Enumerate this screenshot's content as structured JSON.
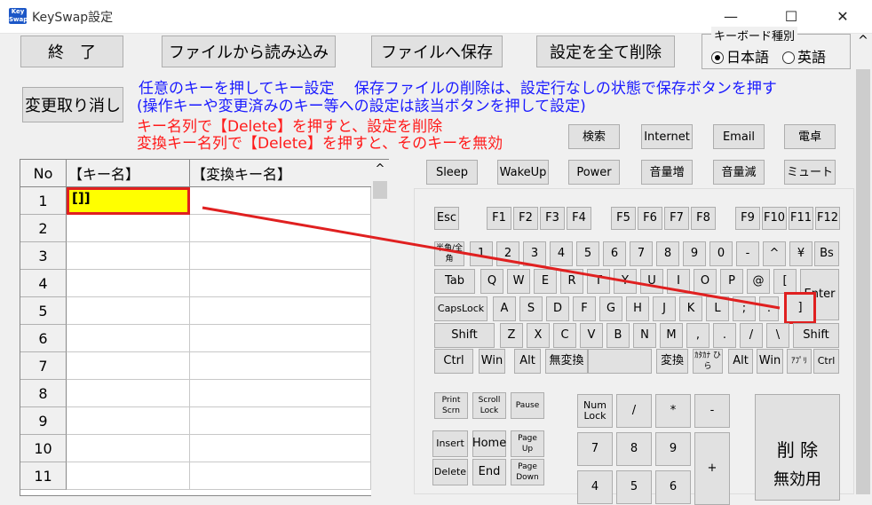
{
  "window": {
    "title": "KeySwap設定",
    "icon_text": "Key Swap",
    "minimize_glyph": "—",
    "maximize_glyph": "☐",
    "close_glyph": "✕"
  },
  "toolbar": {
    "exit_label": "終　了",
    "load_label": "ファイルから読み込み",
    "save_label": "ファイルへ保存",
    "delete_all_label": "設定を全て削除",
    "undo_label": "変更取り消し"
  },
  "keyboard_type": {
    "caption": "キーボード種別",
    "options": [
      {
        "label": "日本語",
        "selected": true
      },
      {
        "label": "英語",
        "selected": false
      }
    ]
  },
  "instructions": {
    "blue_line1": "任意のキーを押してキー設定　  保存ファイルの削除は、設定行なしの状態で保存ボタンを押す",
    "blue_line2": "(操作キーや変更済みのキー等への設定は該当ボタンを押して設定)",
    "red_line1": "キー名列で【Delete】を押すと、設定を削除",
    "red_line2": "変換キー名列で【Delete】を押すと、そのキーを無効"
  },
  "special_keys": {
    "row1": [
      "検索",
      "Internet",
      "Email",
      "電卓"
    ],
    "row2": [
      "Sleep",
      "WakeUp",
      "Power",
      "音量増",
      "音量減",
      "ミュート"
    ]
  },
  "grid": {
    "headers": [
      "No",
      "【キー名】",
      "【変換キー名】"
    ],
    "rows": [
      {
        "no": "1",
        "key": "[]]",
        "mapped": ""
      },
      {
        "no": "2",
        "key": "",
        "mapped": ""
      },
      {
        "no": "3",
        "key": "",
        "mapped": ""
      },
      {
        "no": "4",
        "key": "",
        "mapped": ""
      },
      {
        "no": "5",
        "key": "",
        "mapped": ""
      },
      {
        "no": "6",
        "key": "",
        "mapped": ""
      },
      {
        "no": "7",
        "key": "",
        "mapped": ""
      },
      {
        "no": "8",
        "key": "",
        "mapped": ""
      },
      {
        "no": "9",
        "key": "",
        "mapped": ""
      },
      {
        "no": "10",
        "key": "",
        "mapped": ""
      },
      {
        "no": "11",
        "key": "",
        "mapped": ""
      }
    ],
    "scroll_up_glyph": "^"
  },
  "keyboard": {
    "esc": "Esc",
    "f_group1": [
      "F1",
      "F2",
      "F3",
      "F4"
    ],
    "f_group2": [
      "F5",
      "F6",
      "F7",
      "F8"
    ],
    "f_group3": [
      "F9",
      "F10",
      "F11",
      "F12"
    ],
    "number_row": [
      "半角/全角",
      "1",
      "2",
      "3",
      "4",
      "5",
      "6",
      "7",
      "8",
      "9",
      "0",
      "-",
      "^",
      "¥",
      "Bs"
    ],
    "tab_row": [
      "Tab",
      "Q",
      "W",
      "E",
      "R",
      "T",
      "Y",
      "U",
      "I",
      "O",
      "P",
      "@",
      "[",
      "Enter"
    ],
    "caps_row": [
      "CapsLock",
      "A",
      "S",
      "D",
      "F",
      "G",
      "H",
      "J",
      "K",
      "L",
      ";",
      ":",
      "]"
    ],
    "shift_row": [
      "Shift",
      "Z",
      "X",
      "C",
      "V",
      "B",
      "N",
      "M",
      ",",
      ".",
      "/",
      "\\",
      "Shift"
    ],
    "ctrl_row": [
      "Ctrl",
      "Win",
      "Alt",
      "無変換",
      "",
      "変換",
      "ｶﾀｶﾅ ひら",
      "Alt",
      "Win",
      "ｱﾌﾟﾘ",
      "Ctrl"
    ],
    "nav": {
      "print": "Print Scrn",
      "scroll": "Scroll Lock",
      "pause": "Pause",
      "insert": "Insert",
      "home": "Home",
      "pageup": "Page Up",
      "delete": "Delete",
      "end": "End",
      "pagedown": "Page Down"
    },
    "numpad": {
      "numlock": "Num Lock",
      "div": "/",
      "mul": "*",
      "minus": "-",
      "n7": "7",
      "n8": "8",
      "n9": "9",
      "plus": "+",
      "n4": "4",
      "n5": "5",
      "n6": "6"
    },
    "action_panel": {
      "line1": "削 除",
      "line2": "無効用"
    }
  },
  "colors": {
    "selected_cell_bg": "#ffff00",
    "highlight_border": "#e02020",
    "instruction_blue": "#1a1aff",
    "instruction_red": "#ff1a1a"
  },
  "right_scroll_glyph": "^"
}
